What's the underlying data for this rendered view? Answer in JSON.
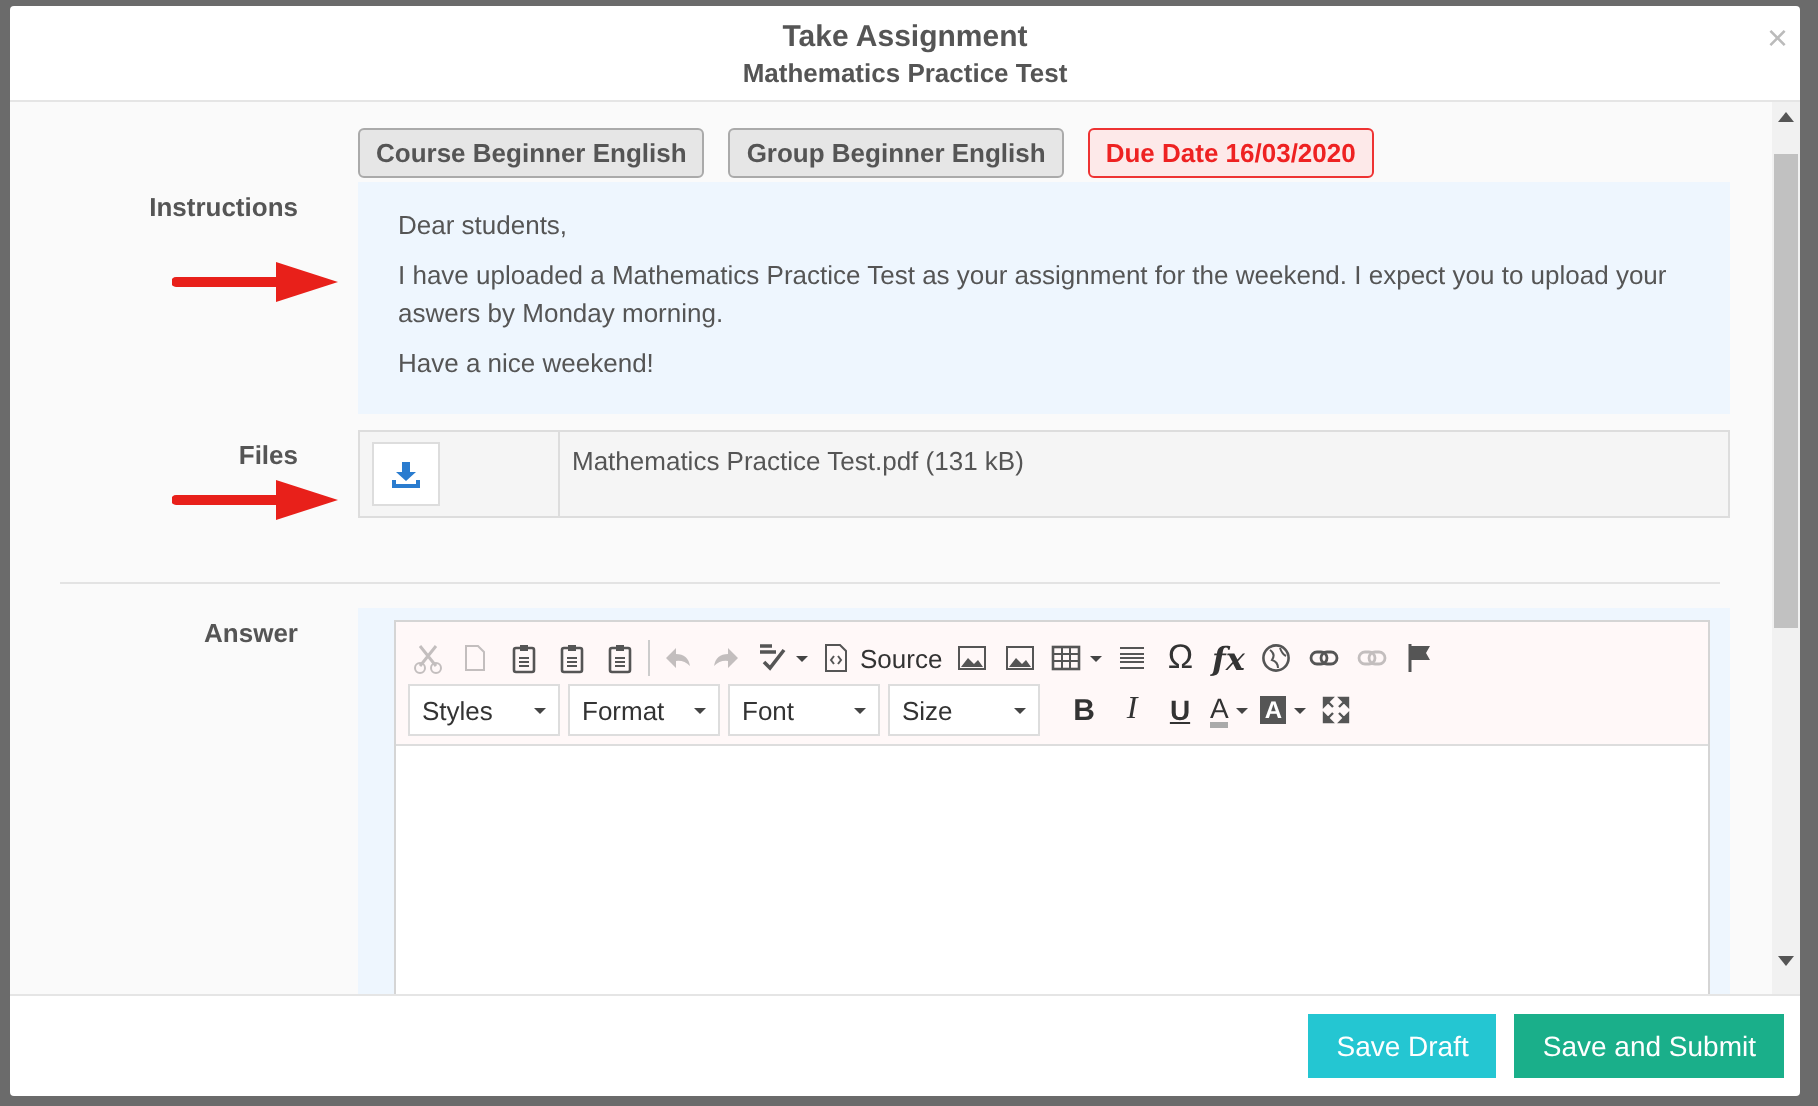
{
  "dialog": {
    "title": "Take Assignment",
    "subtitle": "Mathematics Practice Test",
    "close": "×"
  },
  "tags": [
    {
      "label": "Course Beginner English",
      "kind": "info"
    },
    {
      "label": "Group Beginner English",
      "kind": "info"
    },
    {
      "label": "Due Date 16/03/2020",
      "kind": "alert"
    }
  ],
  "instructions": {
    "label": "Instructions",
    "paragraphs": [
      "Dear students,",
      "I have uploaded a Mathematics Practice Test as your assignment for the weekend. I expect you to upload your aswers by Monday morning.",
      "Have a nice weekend!"
    ]
  },
  "files": {
    "label": "Files",
    "items": [
      {
        "name": "Mathematics Practice Test.pdf (131 kB)"
      }
    ]
  },
  "answer": {
    "label": "Answer",
    "editor": {
      "toolbar": [
        {
          "kind": "cut",
          "disabled": true
        },
        {
          "kind": "copy",
          "disabled": true
        },
        {
          "kind": "paste",
          "disabled": false
        },
        {
          "kind": "paste",
          "disabled": false
        },
        {
          "kind": "paste",
          "disabled": false
        },
        {
          "kind": "separator"
        },
        {
          "kind": "undo",
          "disabled": true
        },
        {
          "kind": "redo",
          "disabled": true
        },
        {
          "kind": "spellcheck",
          "disabled": false
        },
        {
          "kind": "source",
          "label": "Source",
          "disabled": false
        },
        {
          "kind": "image",
          "disabled": false
        },
        {
          "kind": "image",
          "disabled": false
        },
        {
          "kind": "table",
          "disabled": false
        },
        {
          "kind": "rule",
          "disabled": false
        },
        {
          "kind": "glyph",
          "label": "Ω",
          "disabled": false
        },
        {
          "kind": "formula",
          "label": "fx",
          "disabled": false
        },
        {
          "kind": "globe",
          "disabled": false
        },
        {
          "kind": "link",
          "disabled": false
        },
        {
          "kind": "link",
          "disabled": true
        },
        {
          "kind": "flag",
          "disabled": false
        }
      ],
      "combos": [
        {
          "label": "Styles"
        },
        {
          "label": "Format"
        },
        {
          "label": "Font"
        },
        {
          "label": "Size"
        }
      ],
      "format_buttons": [
        {
          "kind": "bold",
          "label": "B"
        },
        {
          "kind": "italic",
          "label": "I"
        },
        {
          "kind": "underline",
          "label": "U"
        },
        {
          "kind": "text-color",
          "label": "A"
        },
        {
          "kind": "background-color",
          "label": "A"
        },
        {
          "kind": "maximize"
        }
      ]
    }
  },
  "buttons": [
    {
      "label": "Save Draft",
      "kind": "secondary"
    },
    {
      "label": "Save and Submit",
      "kind": "primary"
    }
  ]
}
